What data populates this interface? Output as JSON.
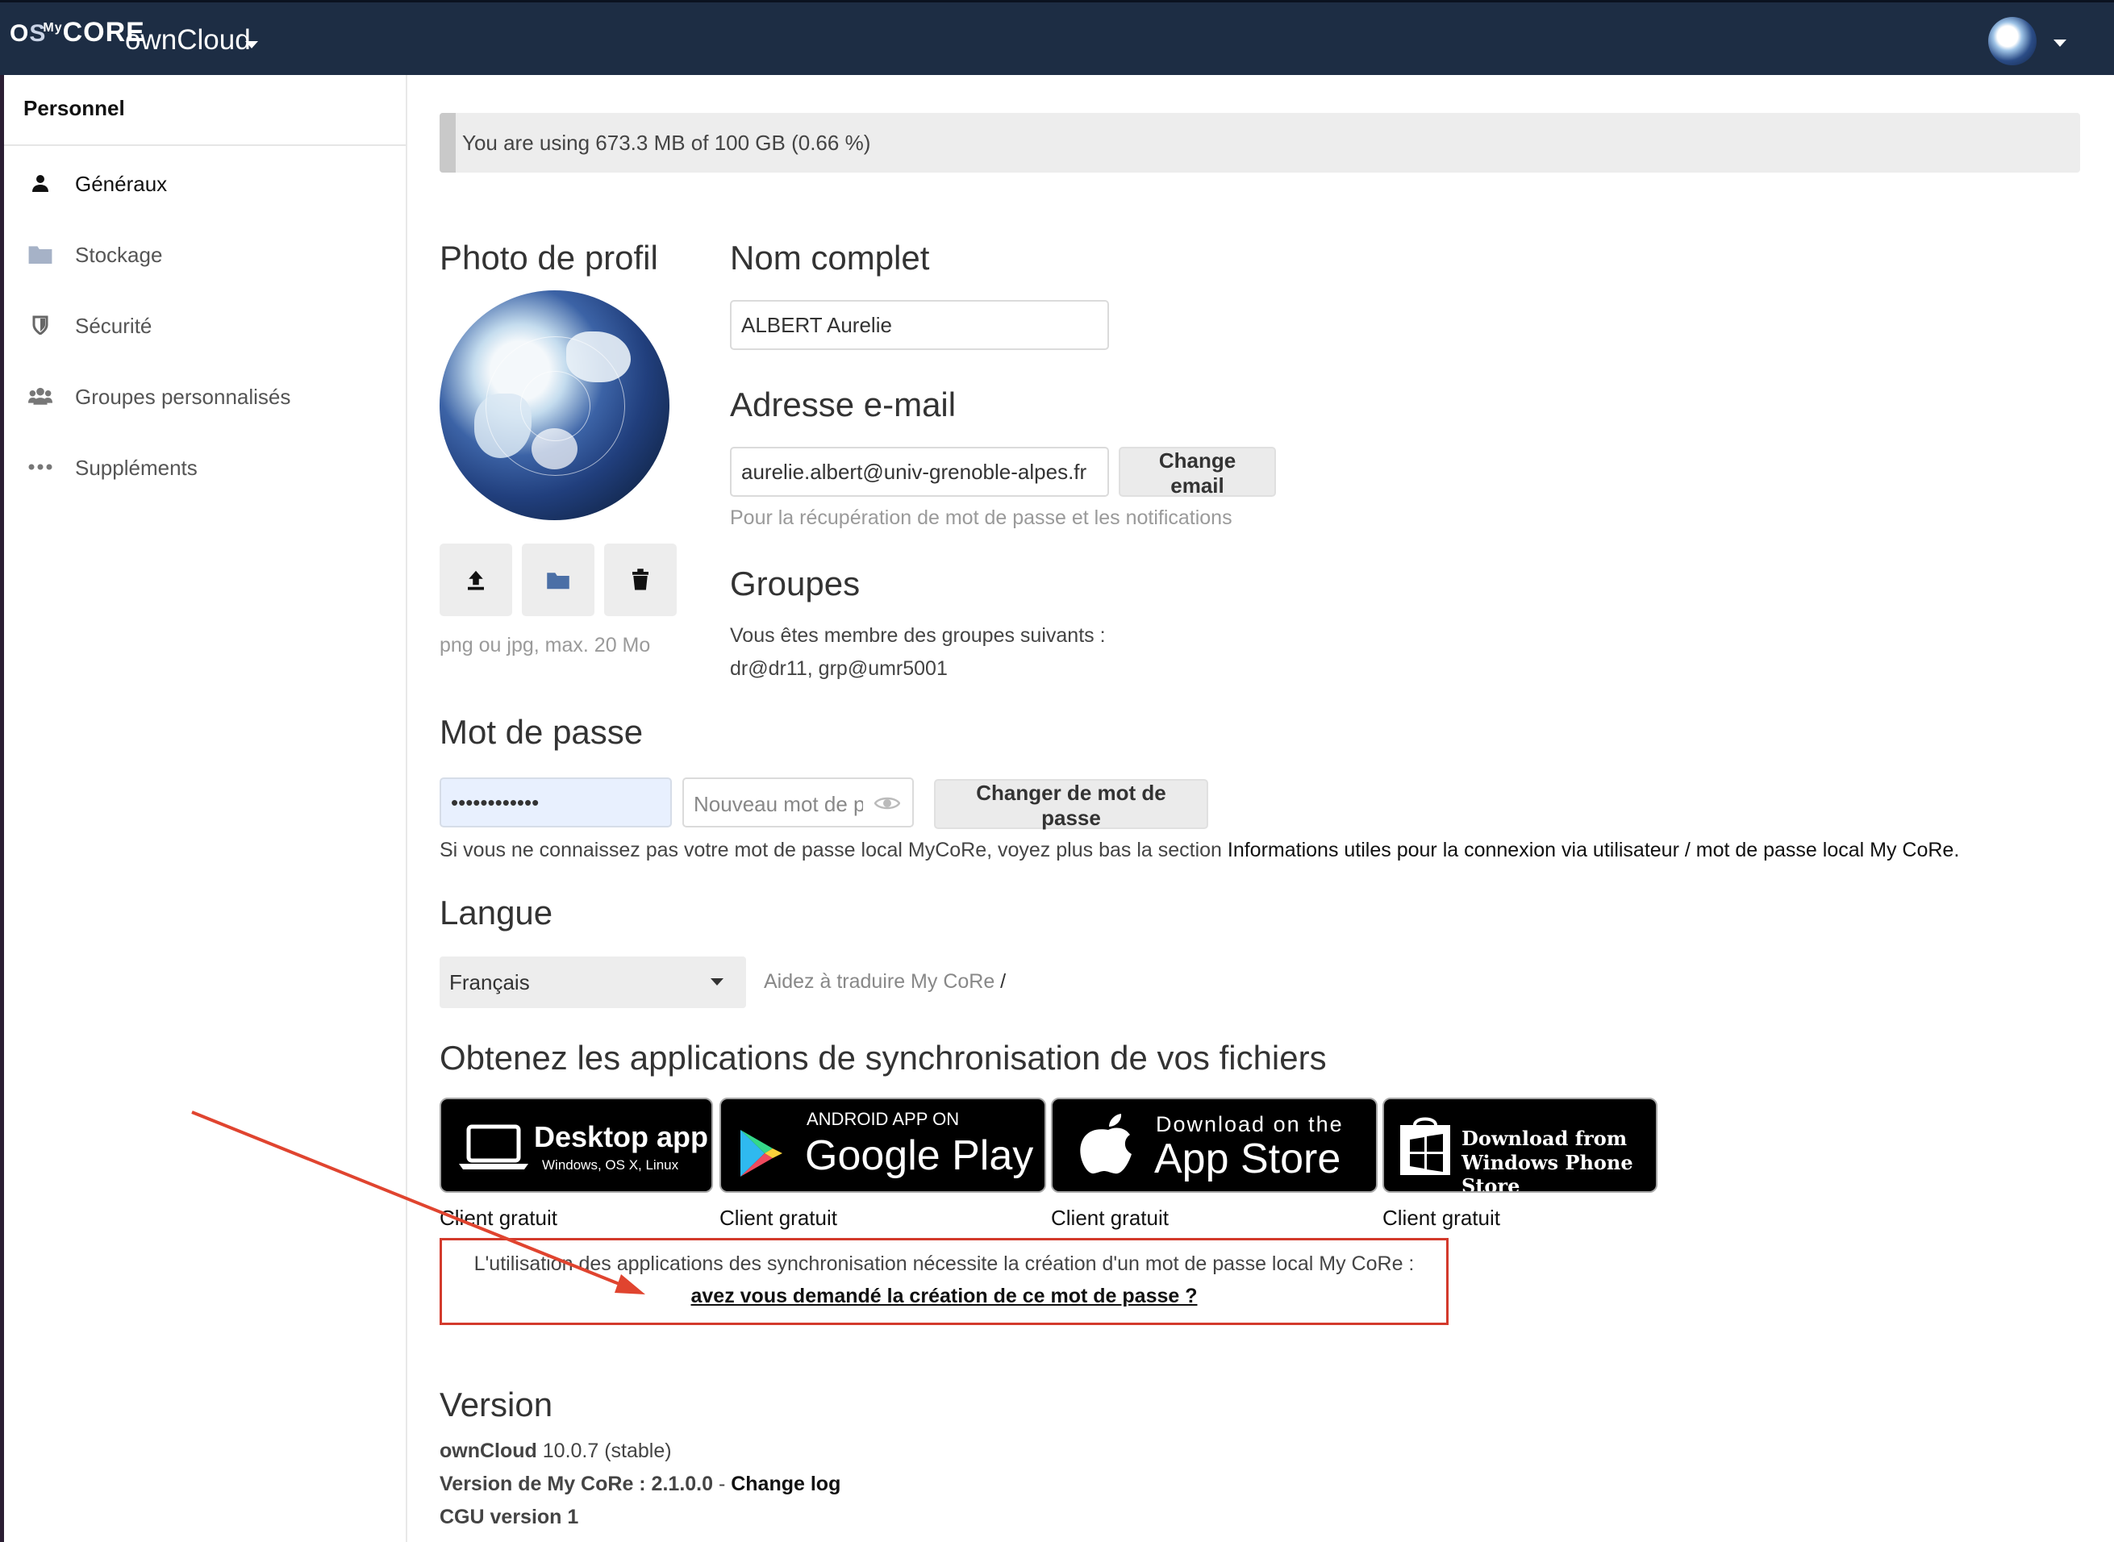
{
  "header": {
    "logo_text": "CORE",
    "logo_super": "My",
    "app_name": "ownCloud",
    "user_menu_icon": "caret-down-icon",
    "colors": {
      "header_bg": "#1d2d44"
    }
  },
  "sidebar": {
    "heading": "Personnel",
    "items": [
      {
        "label": "Généraux",
        "icon": "user-icon"
      },
      {
        "label": "Stockage",
        "icon": "folder-icon"
      },
      {
        "label": "Sécurité",
        "icon": "shield-icon"
      },
      {
        "label": "Groupes personnalisés",
        "icon": "group-icon"
      },
      {
        "label": "Suppléments",
        "icon": "more-icon"
      }
    ]
  },
  "quota": {
    "text": "You are using 673.3 MB of 100 GB (0.66 %)",
    "used_percent": 0.66
  },
  "profile_photo": {
    "heading": "Photo de profil",
    "hint": "png ou jpg, max. 20 Mo",
    "buttons": [
      "upload-icon",
      "folder-icon",
      "trash-icon"
    ]
  },
  "full_name": {
    "heading": "Nom complet",
    "value": "ALBERT Aurelie"
  },
  "email": {
    "heading": "Adresse e-mail",
    "value": "aurelie.albert@univ-grenoble-alpes.fr",
    "button": "Change email",
    "hint": "Pour la récupération de mot de passe et les notifications"
  },
  "groups": {
    "heading": "Groupes",
    "intro": "Vous êtes membre des groupes suivants :",
    "list": "dr@dr11, grp@umr5001"
  },
  "password": {
    "heading": "Mot de passe",
    "current_value": "••••••••••••",
    "new_placeholder": "Nouveau mot de passe",
    "button": "Changer de mot de passe",
    "note_plain": "Si vous ne connaissez pas votre mot de passe local MyCoRe, voyez plus bas la section ",
    "note_emph": "Informations utiles pour la connexion via utilisateur / mot de passe local My CoRe."
  },
  "language": {
    "heading": "Langue",
    "selected": "Français",
    "help_link": "Aidez à traduire My CoRe",
    "help_sep": " /"
  },
  "sync_apps": {
    "heading": "Obtenez les applications de synchronisation de vos fichiers",
    "badges": [
      {
        "title": "Desktop app",
        "subtitle": "Windows, OS X, Linux",
        "caption": "Client gratuit"
      },
      {
        "title": "Google Play",
        "subtitle": "ANDROID APP ON",
        "caption": "Client gratuit"
      },
      {
        "title": "App Store",
        "subtitle": "Download on the",
        "caption": "Client gratuit"
      },
      {
        "title": "Windows Phone Store",
        "subtitle": "Download from",
        "caption": "Client gratuit"
      }
    ],
    "notice_text": "L'utilisation des applications des synchronisation nécessite la création d'un mot de passe local My CoRe :",
    "notice_link": "avez vous demandé la création de ce mot de passe ?",
    "annotation_color": "#d33a2c"
  },
  "version": {
    "heading": "Version",
    "product": "ownCloud",
    "product_version": " 10.0.7 (stable)",
    "mycore_label": "Version de My CoRe : 2.1.0.0",
    "separator": " - ",
    "changelog": "Change log",
    "cgu_label": "CGU",
    "cgu_version": " version 1"
  }
}
